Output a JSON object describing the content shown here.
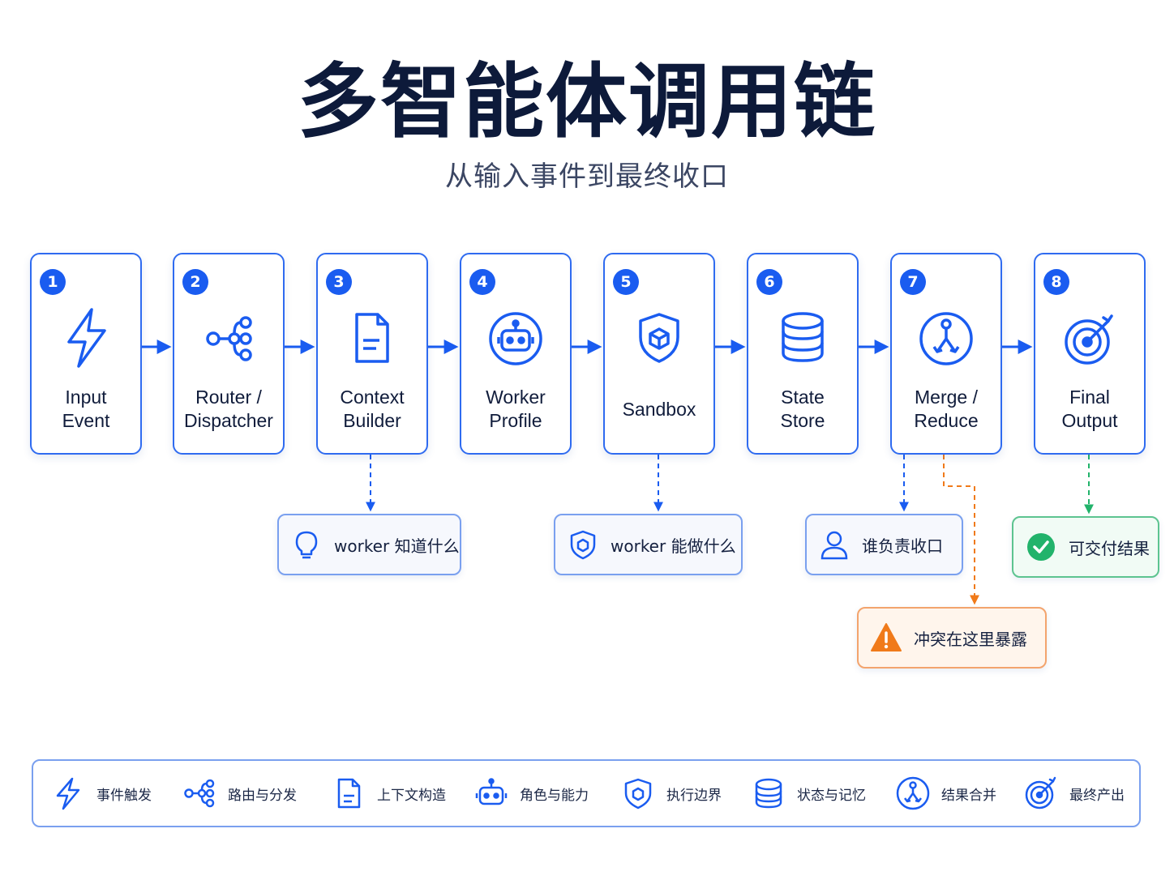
{
  "title": "多智能体调用链",
  "subtitle": "从输入事件到最终收口",
  "colors": {
    "primary": "#1a5cf0",
    "card_border": "#2f6bf0",
    "note_border": "#7aa0ef",
    "success": "#22b36b",
    "warning": "#f07a1a"
  },
  "steps": [
    {
      "number": "1",
      "line1": "Input",
      "line2": "Event",
      "icon": "lightning-icon"
    },
    {
      "number": "2",
      "line1": "Router /",
      "line2": "Dispatcher",
      "icon": "network-icon"
    },
    {
      "number": "3",
      "line1": "Context",
      "line2": "Builder",
      "icon": "document-icon"
    },
    {
      "number": "4",
      "line1": "Worker",
      "line2": "Profile",
      "icon": "robot-icon"
    },
    {
      "number": "5",
      "line1": "Sandbox",
      "line2": "",
      "icon": "shield-cube-icon"
    },
    {
      "number": "6",
      "line1": "State",
      "line2": "Store",
      "icon": "database-icon"
    },
    {
      "number": "7",
      "line1": "Merge /",
      "line2": "Reduce",
      "icon": "merge-icon"
    },
    {
      "number": "8",
      "line1": "Final",
      "line2": "Output",
      "icon": "target-icon"
    }
  ],
  "notes": [
    {
      "text": "worker 知道什么",
      "icon": "lightbulb-icon",
      "from_step": 3
    },
    {
      "text": "worker 能做什么",
      "icon": "shield-icon",
      "from_step": 5
    },
    {
      "text": "谁负责收口",
      "icon": "user-icon",
      "from_step": 7
    },
    {
      "text": "可交付结果",
      "icon": "check-circle-icon",
      "from_step": 8
    },
    {
      "text": "冲突在这里暴露",
      "icon": "warning-icon",
      "from_step": 7
    }
  ],
  "legend": [
    {
      "label": "事件触发",
      "icon": "lightning-icon"
    },
    {
      "label": "路由与分发",
      "icon": "network-icon"
    },
    {
      "label": "上下文构造",
      "icon": "document-icon"
    },
    {
      "label": "角色与能力",
      "icon": "robot-icon"
    },
    {
      "label": "执行边界",
      "icon": "shield-icon"
    },
    {
      "label": "状态与记忆",
      "icon": "database-icon"
    },
    {
      "label": "结果合并",
      "icon": "merge-icon"
    },
    {
      "label": "最终产出",
      "icon": "target-icon"
    }
  ]
}
